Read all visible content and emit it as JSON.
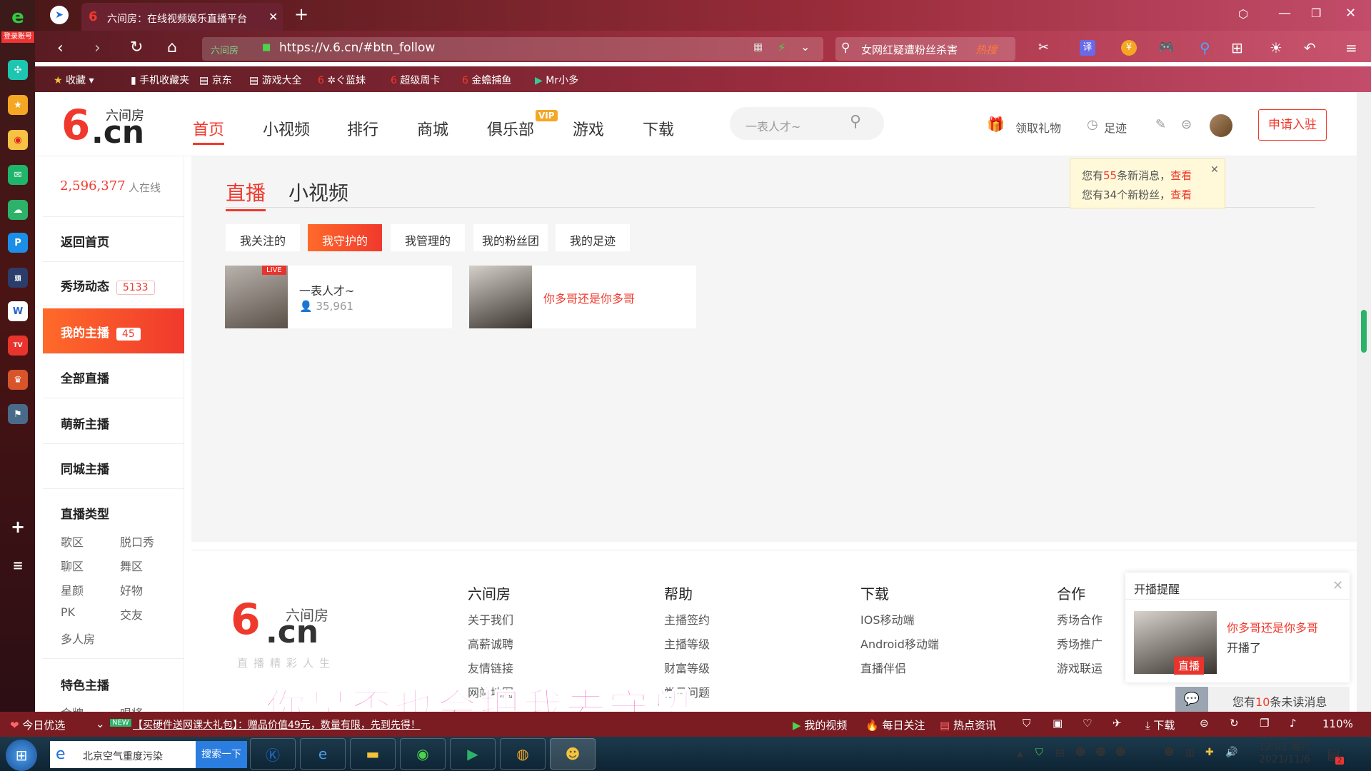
{
  "dock": {
    "login_label": "登录账号",
    "icons": [
      "ie-logo-icon",
      "app-green-icon",
      "star-icon",
      "weibo-icon",
      "mail-icon",
      "cloud-icon",
      "p-app-icon",
      "news-icon",
      "word-icon",
      "tv-app-icon",
      "game-icon",
      "pubg-icon",
      "add-icon",
      "menu-icon"
    ]
  },
  "browser": {
    "tab_title": "六间房：在线视频娱乐直播平台",
    "url": "https://v.6.cn/#btn_follow",
    "url_site_label": "六间房",
    "search_text": "女网红疑遭粉丝杀害",
    "search_badge": "热搜",
    "translate_label": "译"
  },
  "bookmarks": [
    {
      "label": "收藏"
    },
    {
      "label": "手机收藏夹"
    },
    {
      "label": "京东"
    },
    {
      "label": "游戏大全"
    },
    {
      "label": "✲ぐ蓝妹"
    },
    {
      "label": "超级周卡"
    },
    {
      "label": "金蟾捕鱼"
    },
    {
      "label": "Mr小多"
    }
  ],
  "site": {
    "logo_text": "六间房",
    "logo_domain": ".cn",
    "nav": [
      "首页",
      "小视频",
      "排行",
      "商城",
      "俱乐部",
      "游戏",
      "下载"
    ],
    "vip_badge": "VIP",
    "search_placeholder": "一表人才~",
    "gift_label": "领取礼物",
    "footprint_label": "足迹",
    "apply_label": "申请入驻"
  },
  "sidebar": {
    "online_count": "2,596,377",
    "online_label": "人在线",
    "items": [
      {
        "label": "返回首页",
        "badge": ""
      },
      {
        "label": "秀场动态",
        "badge": "5133"
      },
      {
        "label": "我的主播",
        "badge": "45"
      },
      {
        "label": "全部直播",
        "badge": ""
      },
      {
        "label": "萌新主播",
        "badge": ""
      },
      {
        "label": "同城主播",
        "badge": ""
      }
    ],
    "category_title": "直播类型",
    "categories": [
      "歌区",
      "脱口秀",
      "聊区",
      "舞区",
      "星颜",
      "好物",
      "PK",
      "交友",
      "多人房"
    ],
    "featured_title": "特色主播",
    "featured_partial": [
      "金牌",
      "唱将"
    ]
  },
  "main": {
    "tabs": [
      "直播",
      "小视频"
    ],
    "subtabs": [
      "我关注的",
      "我守护的",
      "我管理的",
      "我的粉丝团",
      "我的足迹"
    ],
    "cards": [
      {
        "name": "一表人才~",
        "viewers": "35,961",
        "live": "LIVE"
      },
      {
        "name": "你多哥还是你多哥"
      }
    ]
  },
  "notice": {
    "line1_pre": "您有",
    "line1_num": "55",
    "line1_post": "条新消息，",
    "line1_link": "查看",
    "line2_pre": "您有34个新粉丝，",
    "line2_link": "查看"
  },
  "footer": {
    "brand_logo": "六间房",
    "brand_domain": ".cn",
    "slogan": "直播精彩人生",
    "cols": [
      {
        "title": "六间房",
        "links": [
          "关于我们",
          "高薪诚聘",
          "友情链接",
          "网站地图"
        ]
      },
      {
        "title": "帮助",
        "links": [
          "主播签约",
          "主播等级",
          "财富等级",
          "常见问题"
        ]
      },
      {
        "title": "下载",
        "links": [
          "IOS移动端",
          "Android移动端",
          "直播伴侣"
        ]
      },
      {
        "title": "合作",
        "links": [
          "秀场合作",
          "秀场推广",
          "游戏联运"
        ]
      }
    ]
  },
  "popup": {
    "title": "开播提醒",
    "name": "你多哥还是你多哥",
    "text": "开播了",
    "live_tag": "直播",
    "unread_pre": "您有",
    "unread_num": "10",
    "unread_post": "条未读消息"
  },
  "subtitle": "你是否也会把我去守望",
  "statusbar": {
    "today": "今日优选",
    "news_badge": "NEW",
    "ticker": "【买硬件送网课大礼包】：赠品价值49元，数量有限，先到先得！",
    "my_video": "我的视频",
    "daily": "每日关注",
    "hot_news": "热点资讯",
    "download": "下载",
    "zoom": "110%"
  },
  "taskbar": {
    "search_text": "北京空气重度污染",
    "search_button": "搜索一下",
    "time": "12:01 周六",
    "date": "2021/11/6",
    "badge": "2"
  },
  "colors": {
    "accent": "#f0392d",
    "orange": "#ff6a2a",
    "live": "#e8342d"
  }
}
